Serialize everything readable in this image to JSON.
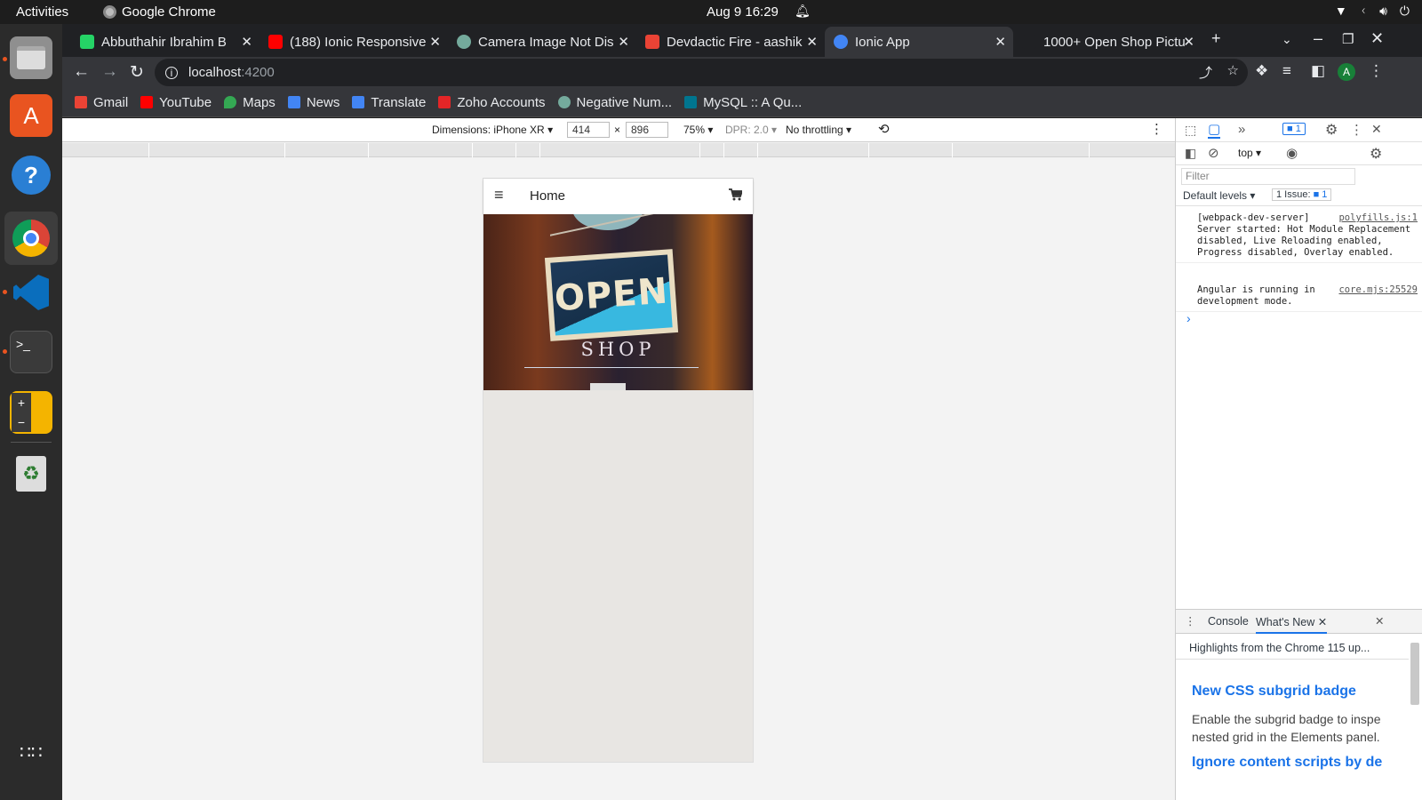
{
  "os": {
    "activities": "Activities",
    "app_name": "Google Chrome",
    "datetime": "Aug 9  16:29"
  },
  "browser": {
    "tabs": [
      {
        "title": "Abbuthahir Ibrahim B",
        "favicon_color": "#25d366"
      },
      {
        "title": "(188) Ionic Responsive",
        "favicon_color": "#ff0000"
      },
      {
        "title": "Camera Image Not Dis",
        "favicon_color": "#74aa9c"
      },
      {
        "title": "Devdactic Fire - aashik",
        "favicon_color": "#ea4335"
      },
      {
        "title": "Ionic App",
        "favicon_color": "#4285f4",
        "active": true
      },
      {
        "title": "1000+ Open Shop Pictu",
        "favicon_color": "#202124"
      }
    ],
    "url_host": "localhost",
    "url_port": ":4200",
    "profile_initial": "A",
    "bookmarks": [
      {
        "label": "Gmail",
        "color": "#ea4335"
      },
      {
        "label": "YouTube",
        "color": "#ff0000"
      },
      {
        "label": "Maps",
        "color": "#34a853"
      },
      {
        "label": "News",
        "color": "#4285f4"
      },
      {
        "label": "Translate",
        "color": "#4285f4"
      },
      {
        "label": "Zoho Accounts",
        "color": "#e42527"
      },
      {
        "label": "Negative Num...",
        "color": "#74aa9c"
      },
      {
        "label": "MySQL :: A Qu...",
        "color": "#00758f"
      }
    ]
  },
  "device_toolbar": {
    "dimensions_label": "Dimensions: iPhone XR",
    "width": "414",
    "x_sep": "×",
    "height": "896",
    "zoom": "75%",
    "dpr": "DPR: 2.0",
    "throttling": "No throttling"
  },
  "app": {
    "header_title": "Home",
    "hero_sign_text": "OPEN",
    "hero_sub_text": "SHOP"
  },
  "devtools": {
    "issue_count_badge": "1",
    "context": "top",
    "filter_placeholder": "Filter",
    "levels": "Default levels",
    "issues_label": "1 Issue:",
    "issues_count": "1",
    "console_messages": [
      {
        "text": "[webpack-dev-server] Server started: Hot Module Replacement disabled, Live Reloading enabled, Progress disabled, Overlay enabled.",
        "source": "polyfills.js:1"
      },
      {
        "text": "Angular is running in development mode.",
        "source": "core.mjs:25529"
      }
    ],
    "prompt": "›",
    "drawer_tabs": [
      "Console",
      "What's New"
    ],
    "whats_new_banner": "Highlights from the Chrome 115 up...",
    "whats_new_items": [
      {
        "title": "New CSS subgrid badge",
        "body": "Enable the subgrid badge to inspe nested grid in the Elements panel."
      },
      {
        "title": "Ignore content scripts by de",
        "body": ""
      }
    ]
  }
}
